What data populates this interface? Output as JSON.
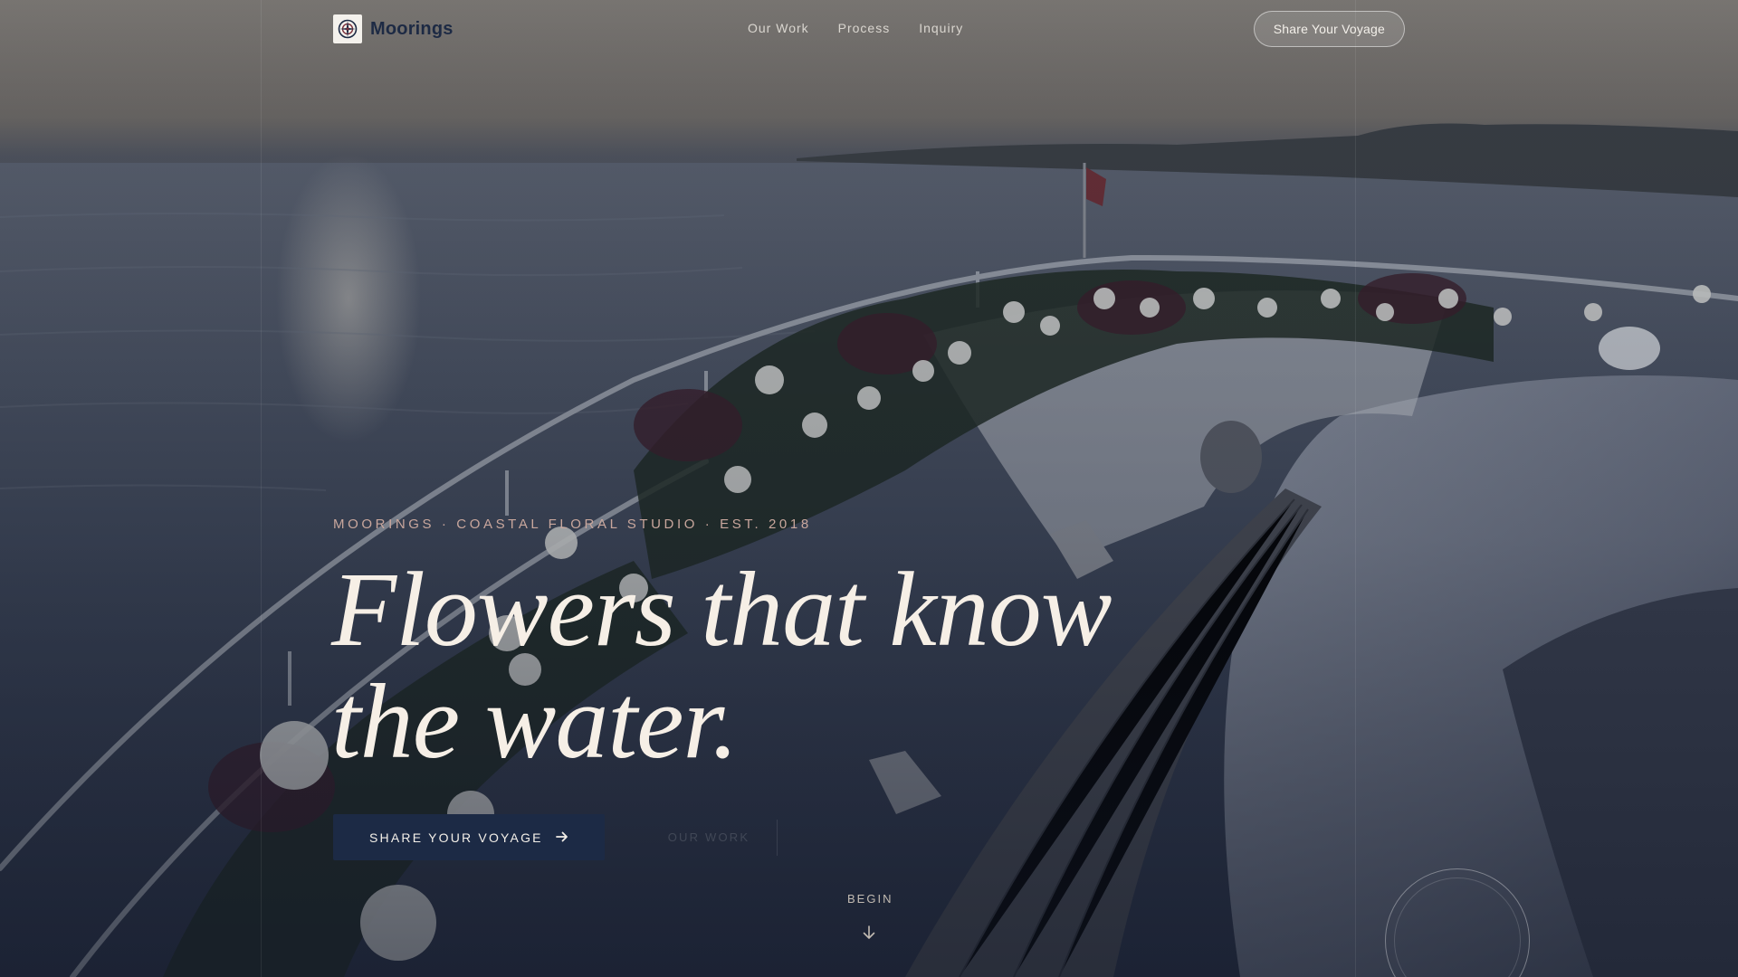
{
  "nav": {
    "brand": "Moorings",
    "links": [
      "Our Work",
      "Process",
      "Inquiry"
    ],
    "cta": "Share Your Voyage"
  },
  "hero": {
    "eyebrow": "MOORINGS · COASTAL FLORAL STUDIO · EST. 2018",
    "headline_line1": "Flowers that know",
    "headline_line2": "the water.",
    "primary_cta": "SHARE YOUR VOYAGE",
    "secondary_cta": "OUR WORK",
    "scroll_label": "BEGIN"
  },
  "icons": {
    "brand": "compass-icon",
    "cta_arrow": "arrow-right-icon",
    "scroll": "arrow-down-icon"
  },
  "colors": {
    "brand_navy": "#1c2a45",
    "eyebrow": "#c9a79d",
    "headline": "#f6efe6"
  }
}
